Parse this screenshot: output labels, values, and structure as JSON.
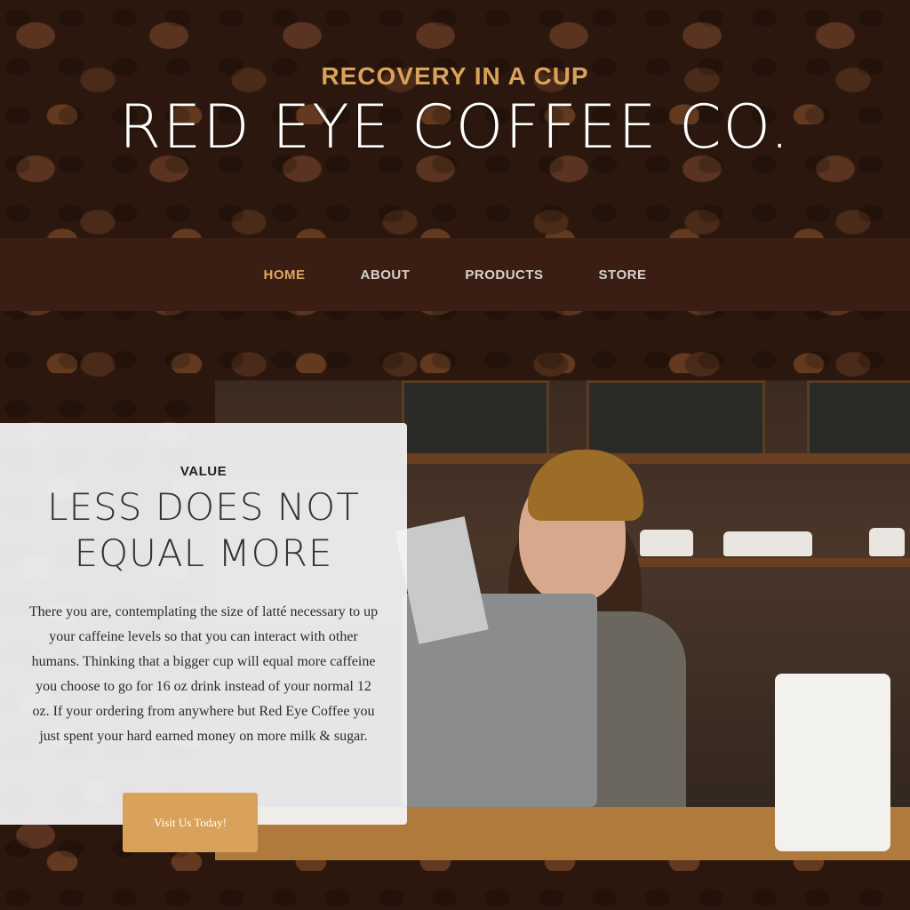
{
  "header": {
    "tagline": "RECOVERY IN A CUP",
    "brand": "RED EYE COFFEE CO."
  },
  "nav": {
    "items": [
      {
        "label": "HOME",
        "active": true
      },
      {
        "label": "ABOUT",
        "active": false
      },
      {
        "label": "PRODUCTS",
        "active": false
      },
      {
        "label": "STORE",
        "active": false
      }
    ]
  },
  "feature": {
    "eyebrow": "VALUE",
    "headline_line1": "LESS DOES NOT",
    "headline_line2": "EQUAL MORE",
    "body": "There you are, contemplating the size of latté necessary to up your caffeine levels so that you can interact with other humans. Thinking that a bigger cup will equal more caffeine you choose to go for 16 oz drink instead of your normal 12 oz. If your ordering from anywhere but Red Eye Coffee you just spent your hard earned money on more milk & sugar.",
    "cta_label": "Visit Us Today!"
  },
  "colors": {
    "accent": "#d9a25a",
    "navbar": "#3a1e13",
    "card": "#f4f4f6"
  },
  "images": {
    "background": "coffee-beans-background",
    "hero": "barista-photo"
  }
}
